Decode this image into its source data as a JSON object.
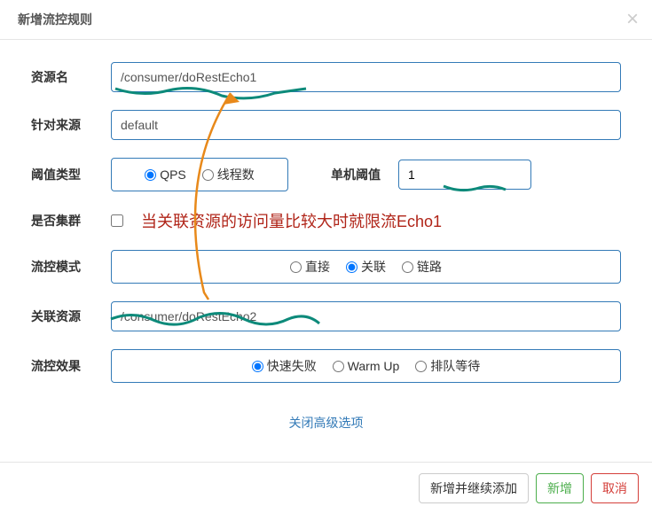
{
  "modal": {
    "title": "新增流控规则",
    "close_label": "×"
  },
  "form": {
    "resource_label": "资源名",
    "resource_value": "/consumer/doRestEcho1",
    "source_label": "针对来源",
    "source_value": "default",
    "threshold_type_label": "阈值类型",
    "threshold_type_options": {
      "qps": "QPS",
      "thread": "线程数"
    },
    "threshold_value_label": "单机阈值",
    "threshold_value": "1",
    "cluster_label": "是否集群",
    "mode_label": "流控模式",
    "mode_options": {
      "direct": "直接",
      "relation": "关联",
      "chain": "链路"
    },
    "relation_label": "关联资源",
    "relation_value": "/consumer/doRestEcho2",
    "effect_label": "流控效果",
    "effect_options": {
      "fail": "快速失败",
      "warmup": "Warm Up",
      "queue": "排队等待"
    },
    "toggle_advanced": "关闭高级选项"
  },
  "annotation": {
    "text": "当关联资源的访问量比较大时就限流Echo1"
  },
  "footer": {
    "add_continue": "新增并继续添加",
    "add": "新增",
    "cancel": "取消"
  }
}
